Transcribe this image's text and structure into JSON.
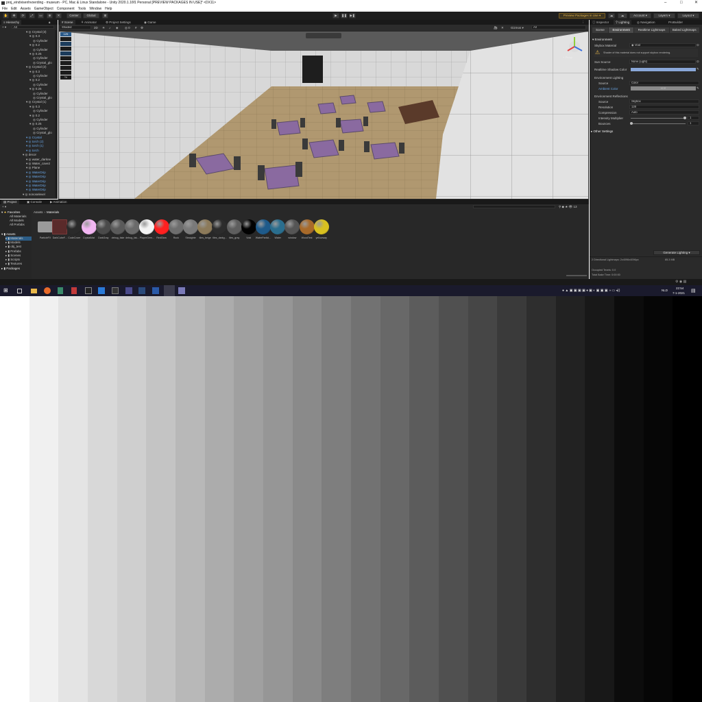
{
  "window": {
    "title": "proj_eindvisenhvoerding - museum - PC, Mac & Linux Standalone - Unity 2020.1.16f1 Personal [PREVIEW PACKAGES IN USE]* <DX11>",
    "minimize": "–",
    "maximize": "□",
    "close": "✕"
  },
  "menu": [
    "File",
    "Edit",
    "Assets",
    "GameObject",
    "Component",
    "Tools",
    "Window",
    "Help"
  ],
  "toolbar": {
    "pivot_center": "Center",
    "pivot_global": "Global",
    "preview_packages": "Preview Packages in Use ▾",
    "account": "Account ▾",
    "layers": "Layers ▾",
    "layout": "Layout ▾"
  },
  "hierarchy": {
    "tab": "Hierarchy",
    "search_placeholder": "All",
    "items": [
      {
        "label": "Crystal (3)",
        "indent": 0,
        "blue": false
      },
      {
        "label": "0.3",
        "indent": 1,
        "blue": false
      },
      {
        "label": "Cylinder",
        "indent": 2,
        "blue": false
      },
      {
        "label": "0.2",
        "indent": 1,
        "blue": false
      },
      {
        "label": "Cylinder",
        "indent": 2,
        "blue": false
      },
      {
        "label": "0.25",
        "indent": 1,
        "blue": false
      },
      {
        "label": "Cylinder",
        "indent": 2,
        "blue": false
      },
      {
        "label": "Crystal_glo",
        "indent": 2,
        "blue": false
      },
      {
        "label": "Crystal (2)",
        "indent": 0,
        "blue": false
      },
      {
        "label": "0.3",
        "indent": 1,
        "blue": false
      },
      {
        "label": "Cylinder",
        "indent": 2,
        "blue": false
      },
      {
        "label": "0.2",
        "indent": 1,
        "blue": false
      },
      {
        "label": "Cylinder",
        "indent": 2,
        "blue": false
      },
      {
        "label": "0.25",
        "indent": 1,
        "blue": false
      },
      {
        "label": "Cylinder",
        "indent": 2,
        "blue": false
      },
      {
        "label": "Crystal_glo",
        "indent": 2,
        "blue": false
      },
      {
        "label": "Crystal (1)",
        "indent": 0,
        "blue": false
      },
      {
        "label": "0.3",
        "indent": 1,
        "blue": false
      },
      {
        "label": "Cylinder",
        "indent": 2,
        "blue": false
      },
      {
        "label": "0.2",
        "indent": 1,
        "blue": false
      },
      {
        "label": "Cylinder",
        "indent": 2,
        "blue": false
      },
      {
        "label": "0.25",
        "indent": 1,
        "blue": false
      },
      {
        "label": "Cylinder",
        "indent": 2,
        "blue": false
      },
      {
        "label": "Crystal_glo",
        "indent": 2,
        "blue": false
      },
      {
        "label": "Crystal",
        "indent": 0,
        "blue": true
      },
      {
        "label": "torch (2)",
        "indent": 0,
        "blue": true
      },
      {
        "label": "torch (1)",
        "indent": 0,
        "blue": true
      },
      {
        "label": "torch",
        "indent": 0,
        "blue": true
      },
      {
        "label": "decor",
        "indent": -1,
        "blue": false
      },
      {
        "label": "water_darkne",
        "indent": 0,
        "blue": false
      },
      {
        "label": "Water_cave2",
        "indent": 0,
        "blue": false
      },
      {
        "label": "Plane",
        "indent": 0,
        "blue": false
      },
      {
        "label": "WaterDrip",
        "indent": 0,
        "blue": true
      },
      {
        "label": "WaterDrip",
        "indent": 0,
        "blue": true
      },
      {
        "label": "WaterDrip",
        "indent": 0,
        "blue": true
      },
      {
        "label": "WaterDrip",
        "indent": 0,
        "blue": true
      },
      {
        "label": "WaterDrip",
        "indent": 0,
        "blue": true
      },
      {
        "label": "nonoselevel",
        "indent": -1,
        "blue": false
      }
    ]
  },
  "scene_tabs": [
    "Scene",
    "Animator",
    "Project Settings",
    "Game"
  ],
  "scene_toolbar": {
    "shading": "Shaded",
    "mode_2d": "2D",
    "gizmos": "Gizmos ▾",
    "search_placeholder": "All"
  },
  "scene_overlay": {
    "persp_label": "< Persp",
    "badges": [
      "125",
      "",
      "",
      "",
      "",
      "",
      "",
      "",
      "",
      "Tri"
    ]
  },
  "project": {
    "tabs": [
      "Project",
      "Console",
      "Animation"
    ],
    "breadcrumb": [
      "Assets",
      "Materials"
    ],
    "favorites_label": "Favorites",
    "favorites": [
      "All Materials",
      "All Models",
      "All Prefabs"
    ],
    "assets_label": "Assets",
    "folders": [
      "Materials",
      "Models",
      "obj_test",
      "Prefabs",
      "Scenes",
      "Scripts",
      "Textures"
    ],
    "packages_label": "Packages",
    "materials": [
      {
        "label": "ParticleFX",
        "color": "#9a9a9a",
        "type": "folder"
      },
      {
        "label": "DarkCubeF...",
        "color": "#5a2a2a",
        "type": "cube"
      },
      {
        "label": "CodeCover",
        "color": "#2a2a2a",
        "type": "sphere"
      },
      {
        "label": "CrystalMat",
        "color": "#f2b6f2",
        "type": "sphere"
      },
      {
        "label": "DarkGray",
        "color": "#4a4a4a",
        "type": "sphere"
      },
      {
        "label": "debug_fake",
        "color": "#5a5a5a",
        "type": "sphere"
      },
      {
        "label": "debug_fak...",
        "color": "#6a6a6a",
        "type": "sphere"
      },
      {
        "label": "PlayerGem...",
        "color": "#f4f4f4",
        "type": "sphere"
      },
      {
        "label": "RedGlow",
        "color": "#ff2020",
        "type": "sphere"
      },
      {
        "label": "Rock",
        "color": "#6e6e6e",
        "type": "sphere"
      },
      {
        "label": "Steaighte",
        "color": "#7a7a7a",
        "type": "sphere"
      },
      {
        "label": "tiles_beige",
        "color": "#8c7a5a",
        "type": "sphere"
      },
      {
        "label": "tiles_darkg...",
        "color": "#2c2c2c",
        "type": "sphere"
      },
      {
        "label": "tiles_gray",
        "color": "#5e5e5e",
        "type": "sphere"
      },
      {
        "label": "Void",
        "color": "#020202",
        "type": "sphere"
      },
      {
        "label": "WaterParticl...",
        "color": "#1e5a8a",
        "type": "sphere"
      },
      {
        "label": "Water",
        "color": "#2a6e8e",
        "type": "sphere"
      },
      {
        "label": "window",
        "color": "#555555",
        "type": "sphere"
      },
      {
        "label": "WoodTest",
        "color": "#a86a2a",
        "type": "sphere"
      },
      {
        "label": "yellowway",
        "color": "#d8c020",
        "type": "sphere"
      }
    ]
  },
  "inspector": {
    "tabs": [
      "Inspector",
      "Lighting",
      "Navigation",
      "ProBuilder"
    ],
    "subtabs": [
      "Scene",
      "Environment",
      "Realtime Lightmaps",
      "Baked Lightmaps"
    ],
    "section_environment": "Environment",
    "skybox_material_label": "Skybox Material",
    "skybox_material_value": "Void",
    "warning": "Shader of this material does not support skybox rendering.",
    "sun_source_label": "Sun Source",
    "sun_source_value": "None (Light)",
    "shadow_color_label": "Realtime Shadow Color",
    "env_lighting_label": "Environment Lighting",
    "source_label": "Source",
    "source_value": "Color",
    "ambient_color_label": "Ambient Color",
    "ambient_color_value": "HDR",
    "env_reflections_label": "Environment Reflections",
    "refl_source_label": "Source",
    "refl_source_value": "Skybox",
    "resolution_label": "Resolution",
    "resolution_value": "128",
    "compression_label": "Compression",
    "compression_value": "Auto",
    "intensity_label": "Intensity Multiplier",
    "intensity_value": "1",
    "bounces_label": "Bounces",
    "bounces_value": "1",
    "other_settings": "Other Settings",
    "generate_button": "Generate Lighting ▾",
    "stats_lightmaps": "2 Directional Lightmaps: 2x4096x4096px",
    "stats_size": "85.3 MB",
    "stats_texels": "Occupied Texels: 0.0",
    "stats_bake_time": "Total Bake Time: 0:00:00"
  },
  "taskbar": {
    "lang": "NLD",
    "time": "22:54",
    "date": "7-1-2021"
  },
  "colors": {
    "editor_bg": "#282828",
    "accent_blue": "#3a72b0",
    "warning_yellow": "#e8b74a",
    "shadow_color_bar": "#8aa7d8"
  }
}
